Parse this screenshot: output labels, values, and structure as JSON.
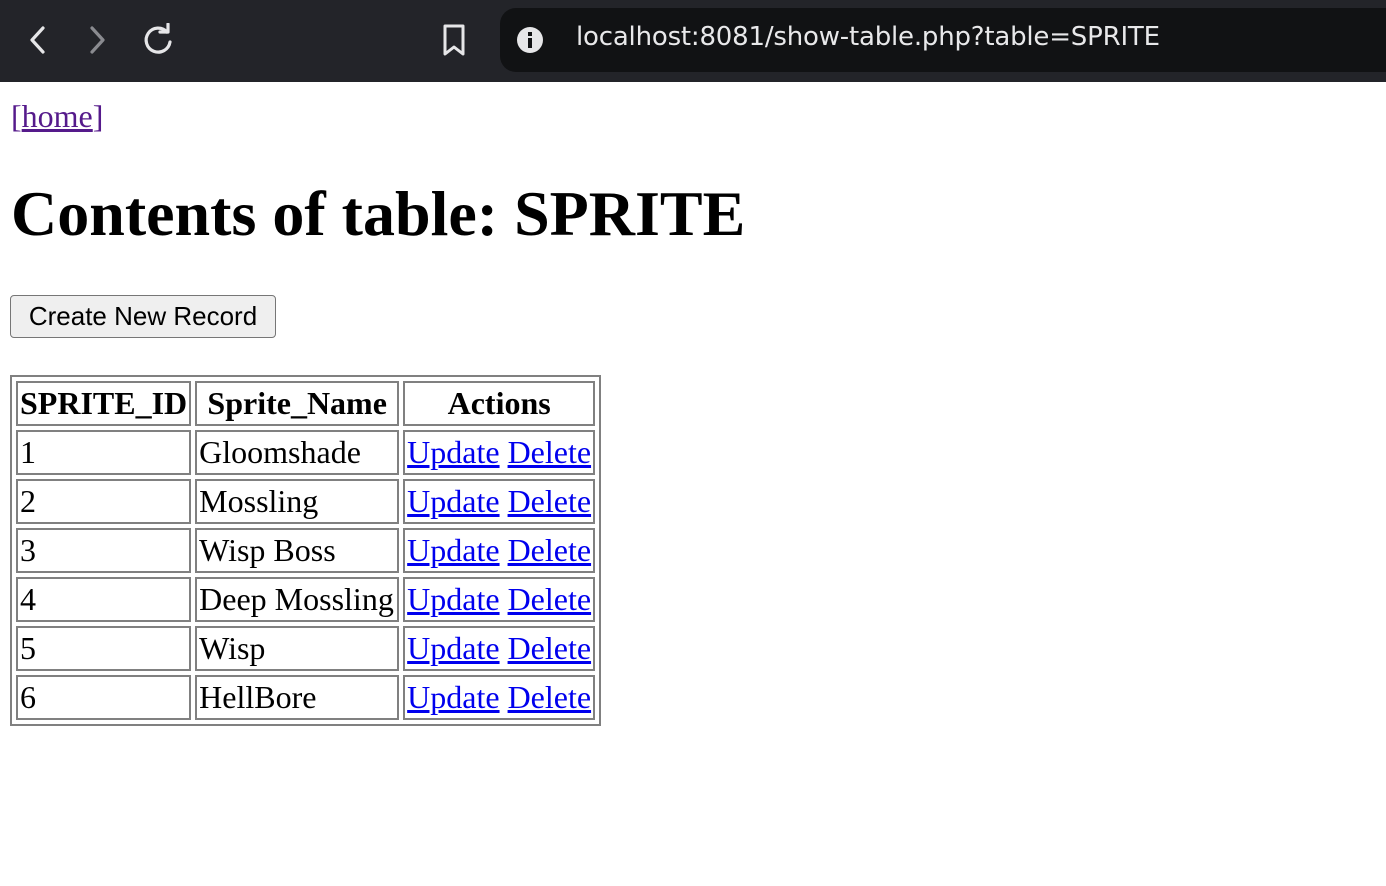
{
  "browser": {
    "url": "localhost:8081/show-table.php?table=SPRITE",
    "icons": {
      "back": "back-arrow-icon",
      "forward": "forward-arrow-icon",
      "reload": "reload-icon",
      "bookmark": "bookmark-icon",
      "info": "info-icon"
    },
    "colors": {
      "toolbar_bg": "#232429",
      "urlbar_bg": "#111214"
    }
  },
  "page": {
    "home_bracket_open": "[",
    "home_link": "home",
    "home_bracket_close": "]",
    "title": "Contents of table: SPRITE",
    "create_button": "Create New Record",
    "table": {
      "headers": [
        "SPRITE_ID",
        "Sprite_Name",
        "Actions"
      ],
      "rows": [
        {
          "id": "1",
          "name": "Gloomshade",
          "update": "Update",
          "delete": "Delete"
        },
        {
          "id": "2",
          "name": "Mossling",
          "update": "Update",
          "delete": "Delete"
        },
        {
          "id": "3",
          "name": "Wisp Boss",
          "update": "Update",
          "delete": "Delete"
        },
        {
          "id": "4",
          "name": "Deep Mossling",
          "update": "Update",
          "delete": "Delete"
        },
        {
          "id": "5",
          "name": "Wisp",
          "update": "Update",
          "delete": "Delete"
        },
        {
          "id": "6",
          "name": "HellBore",
          "update": "Update",
          "delete": "Delete"
        }
      ]
    },
    "colors": {
      "link": "#0000ee",
      "visited_link": "#551a8b"
    }
  }
}
